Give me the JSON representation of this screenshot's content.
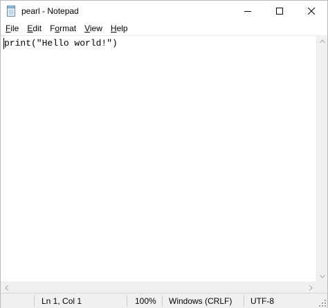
{
  "window": {
    "title": "pearl - Notepad"
  },
  "menu": {
    "items": [
      {
        "accel": "F",
        "rest": "ile"
      },
      {
        "accel": "E",
        "rest": "dit"
      },
      {
        "accel": "F",
        "rest": "ormat",
        "accel_underlined": "o"
      },
      {
        "accel": "V",
        "rest": "iew"
      },
      {
        "accel": "H",
        "rest": "elp"
      }
    ]
  },
  "editor": {
    "content": "print(\"Hello world!\")"
  },
  "status": {
    "position": "Ln 1, Col 1",
    "zoom": "100%",
    "line_ending": "Windows (CRLF)",
    "encoding": "UTF-8"
  },
  "icons": {
    "app": "notepad-icon",
    "minimize": "minimize-icon",
    "maximize": "maximize-icon",
    "close": "close-icon"
  },
  "colors": {
    "statusbar_bg": "#f0f0f0",
    "window_border": "#b9b9b9"
  }
}
